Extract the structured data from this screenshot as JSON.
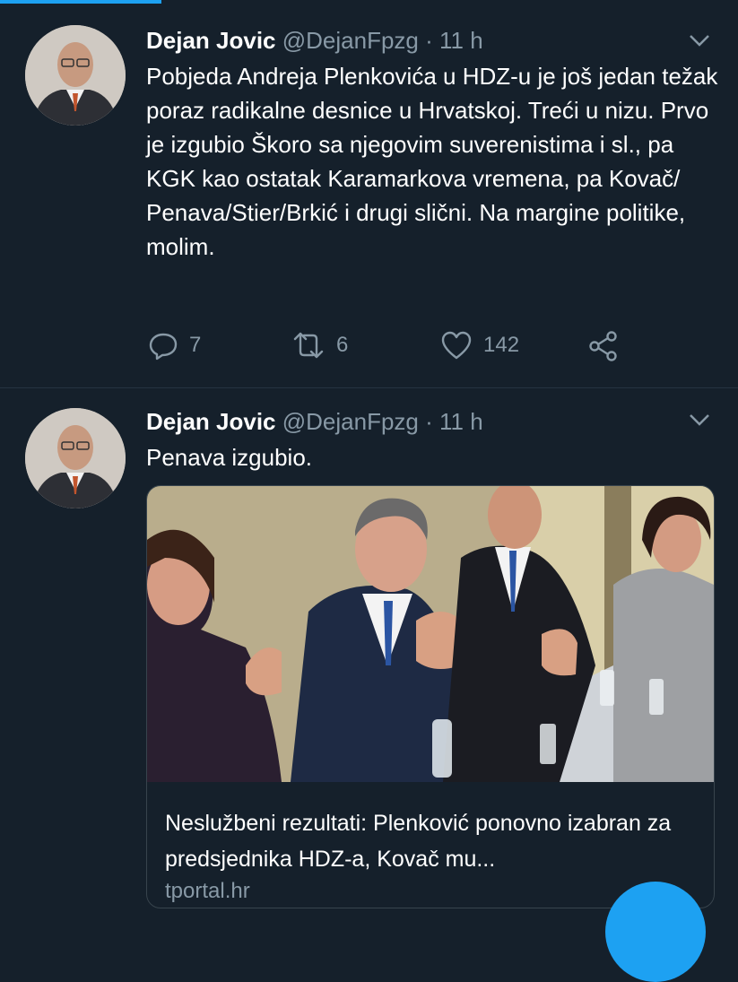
{
  "tweets": [
    {
      "name": "Dejan Jovic",
      "handle": "@DejanFpzg",
      "separator": "·",
      "time": "11 h",
      "text": "Pobjeda Andreja Plenkovića u HDZ-u je još jedan težak poraz radikalne desnice u Hrvatskoj. Treći u nizu. Prvo je izgubio Škoro sa njegovim suverenistima i sl., pa KGK kao ostatak Karamarkova vremena, pa Kovač/ Penava/Stier/Brkić i drugi slični. Na margine politike, molim.",
      "replies": "7",
      "retweets": "6",
      "likes": "142"
    },
    {
      "name": "Dejan Jovic",
      "handle": "@DejanFpzg",
      "separator": "·",
      "time": "11 h",
      "text": "Penava izgubio.",
      "card": {
        "title": "Neslužbeni rezultati: Plenković ponovno izabran za predsjednika HDZ-a, Kovač mu...",
        "domain": "tportal.hr"
      }
    }
  ],
  "icons": [
    "avatar",
    "chevron-down-icon",
    "reply-icon",
    "retweet-icon",
    "like-icon",
    "share-icon",
    "compose-fab"
  ],
  "colors": {
    "background": "#15202b",
    "secondary_text": "#8899a6",
    "accent": "#1da1f2",
    "border": "#38444d"
  }
}
